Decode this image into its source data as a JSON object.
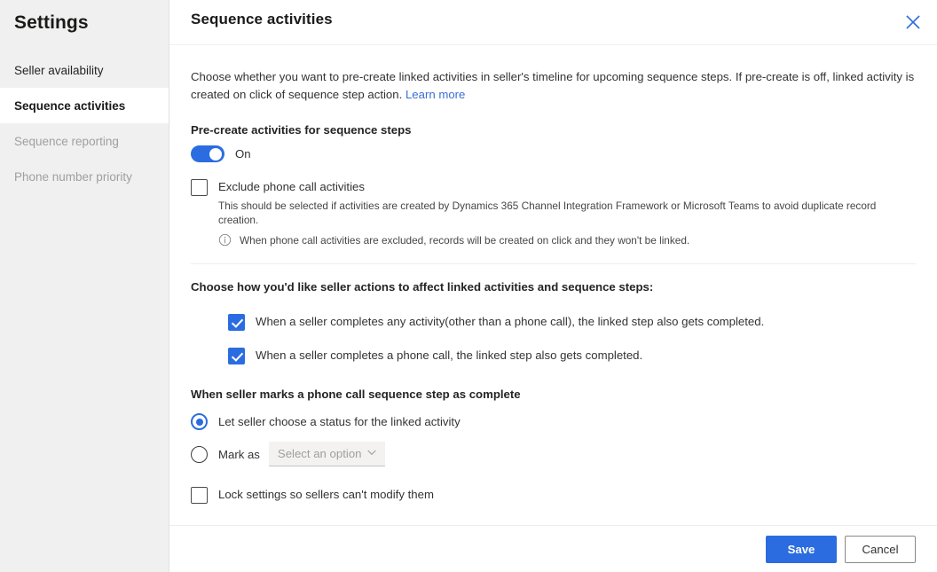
{
  "sidebar": {
    "title": "Settings",
    "items": [
      {
        "label": "Seller availability",
        "state": "normal"
      },
      {
        "label": "Sequence activities",
        "state": "selected"
      },
      {
        "label": "Sequence reporting",
        "state": "disabled"
      },
      {
        "label": "Phone number priority",
        "state": "disabled"
      }
    ]
  },
  "panel": {
    "title": "Sequence activities",
    "close_icon": "close-icon",
    "description": "Choose whether you want to pre-create linked activities in seller's timeline for upcoming sequence steps. If pre-create is off, linked activity is created on click of sequence step action.",
    "learn_more": "Learn more"
  },
  "precreate": {
    "heading": "Pre-create activities for sequence steps",
    "toggle_state": "On",
    "toggle_on": true,
    "exclude": {
      "label": "Exclude phone call activities",
      "checked": false,
      "help": "This should be selected if activities are created by Dynamics 365 Channel Integration Framework or Microsoft Teams to avoid duplicate record creation.",
      "note_icon": "info-icon",
      "note": "When phone call activities are excluded, records will be created on click and they won't be linked."
    }
  },
  "seller_actions": {
    "heading": "Choose how you'd like seller actions to affect linked activities and sequence steps:",
    "options": [
      {
        "label": "When a seller completes any activity(other than a phone call), the linked step also gets completed.",
        "checked": true
      },
      {
        "label": "When a seller completes a phone call, the linked step also gets completed.",
        "checked": true
      }
    ]
  },
  "phone_complete": {
    "heading": "When seller marks a phone call sequence step as complete",
    "radios": [
      {
        "label": "Let seller choose a status for the linked activity",
        "selected": true
      },
      {
        "label": "Mark as",
        "selected": false
      }
    ],
    "dropdown": {
      "placeholder": "Select an option",
      "chevron_icon": "chevron-down-icon"
    }
  },
  "lock": {
    "label": "Lock settings so sellers can't modify them",
    "checked": false
  },
  "footer": {
    "save_label": "Save",
    "cancel_label": "Cancel"
  },
  "colors": {
    "accent": "#2b6ce0",
    "link": "#3b6ed4",
    "sidebar_bg": "#f0f0f0"
  }
}
